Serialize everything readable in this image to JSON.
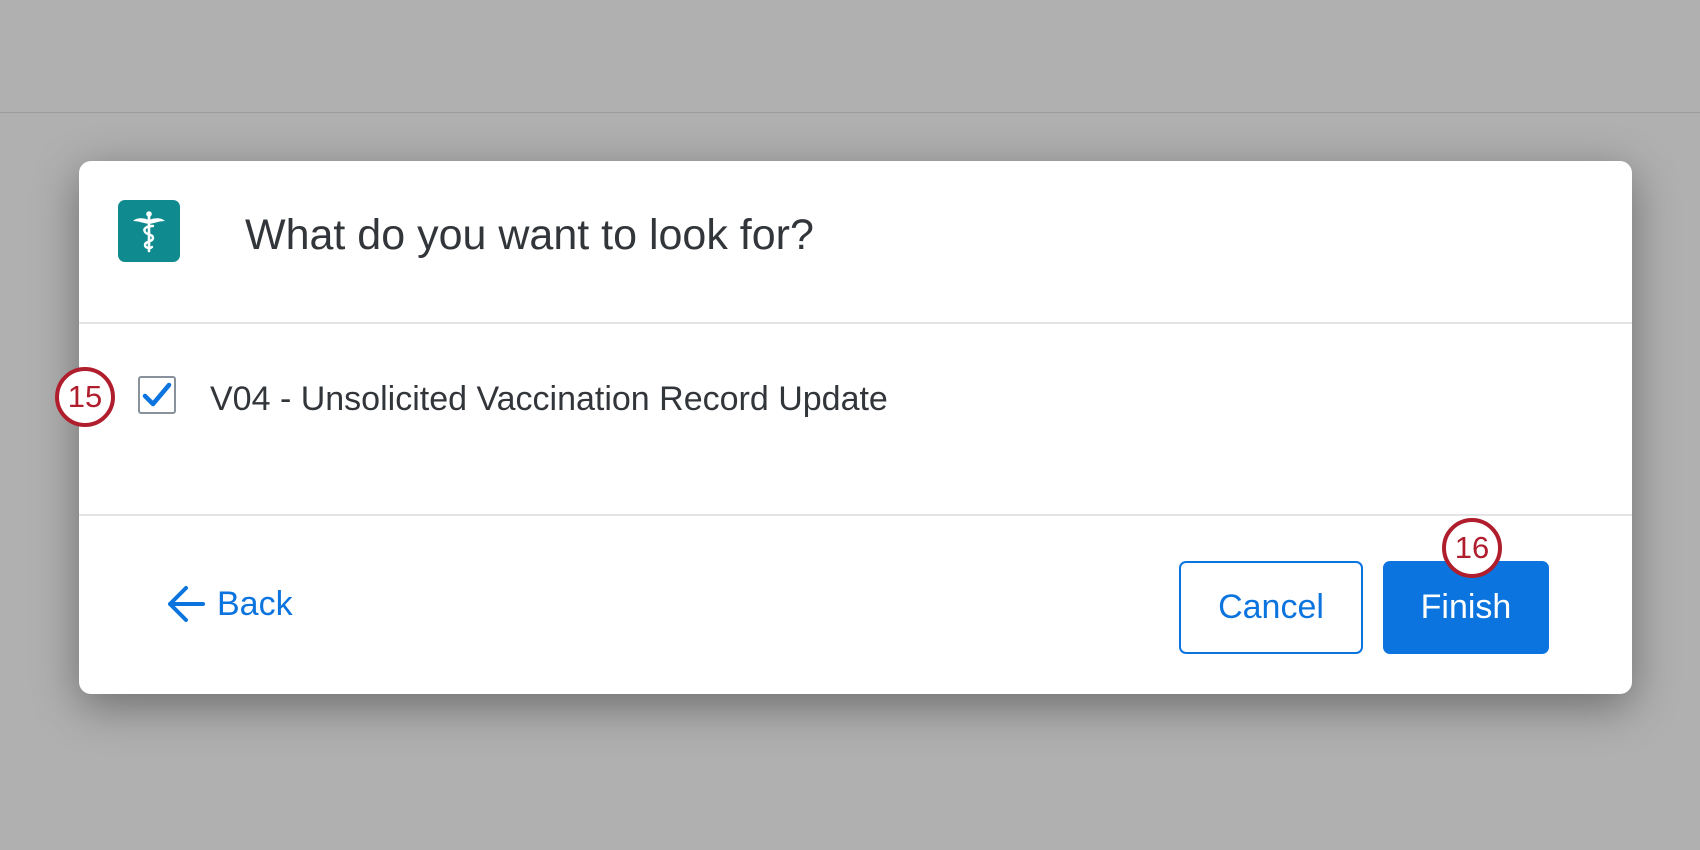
{
  "modal": {
    "title": "What do you want to look for?",
    "icon": "caduceus-icon"
  },
  "item": {
    "label": "V04 - Unsolicited Vaccination Record Update",
    "checked": true
  },
  "footer": {
    "back_label": "Back",
    "cancel_label": "Cancel",
    "finish_label": "Finish"
  },
  "callouts": {
    "step_checkbox": "15",
    "step_finish": "16"
  },
  "colors": {
    "accent": "#0b74de",
    "icon_bg": "#0f8a8e",
    "callout": "#b01e2e"
  }
}
